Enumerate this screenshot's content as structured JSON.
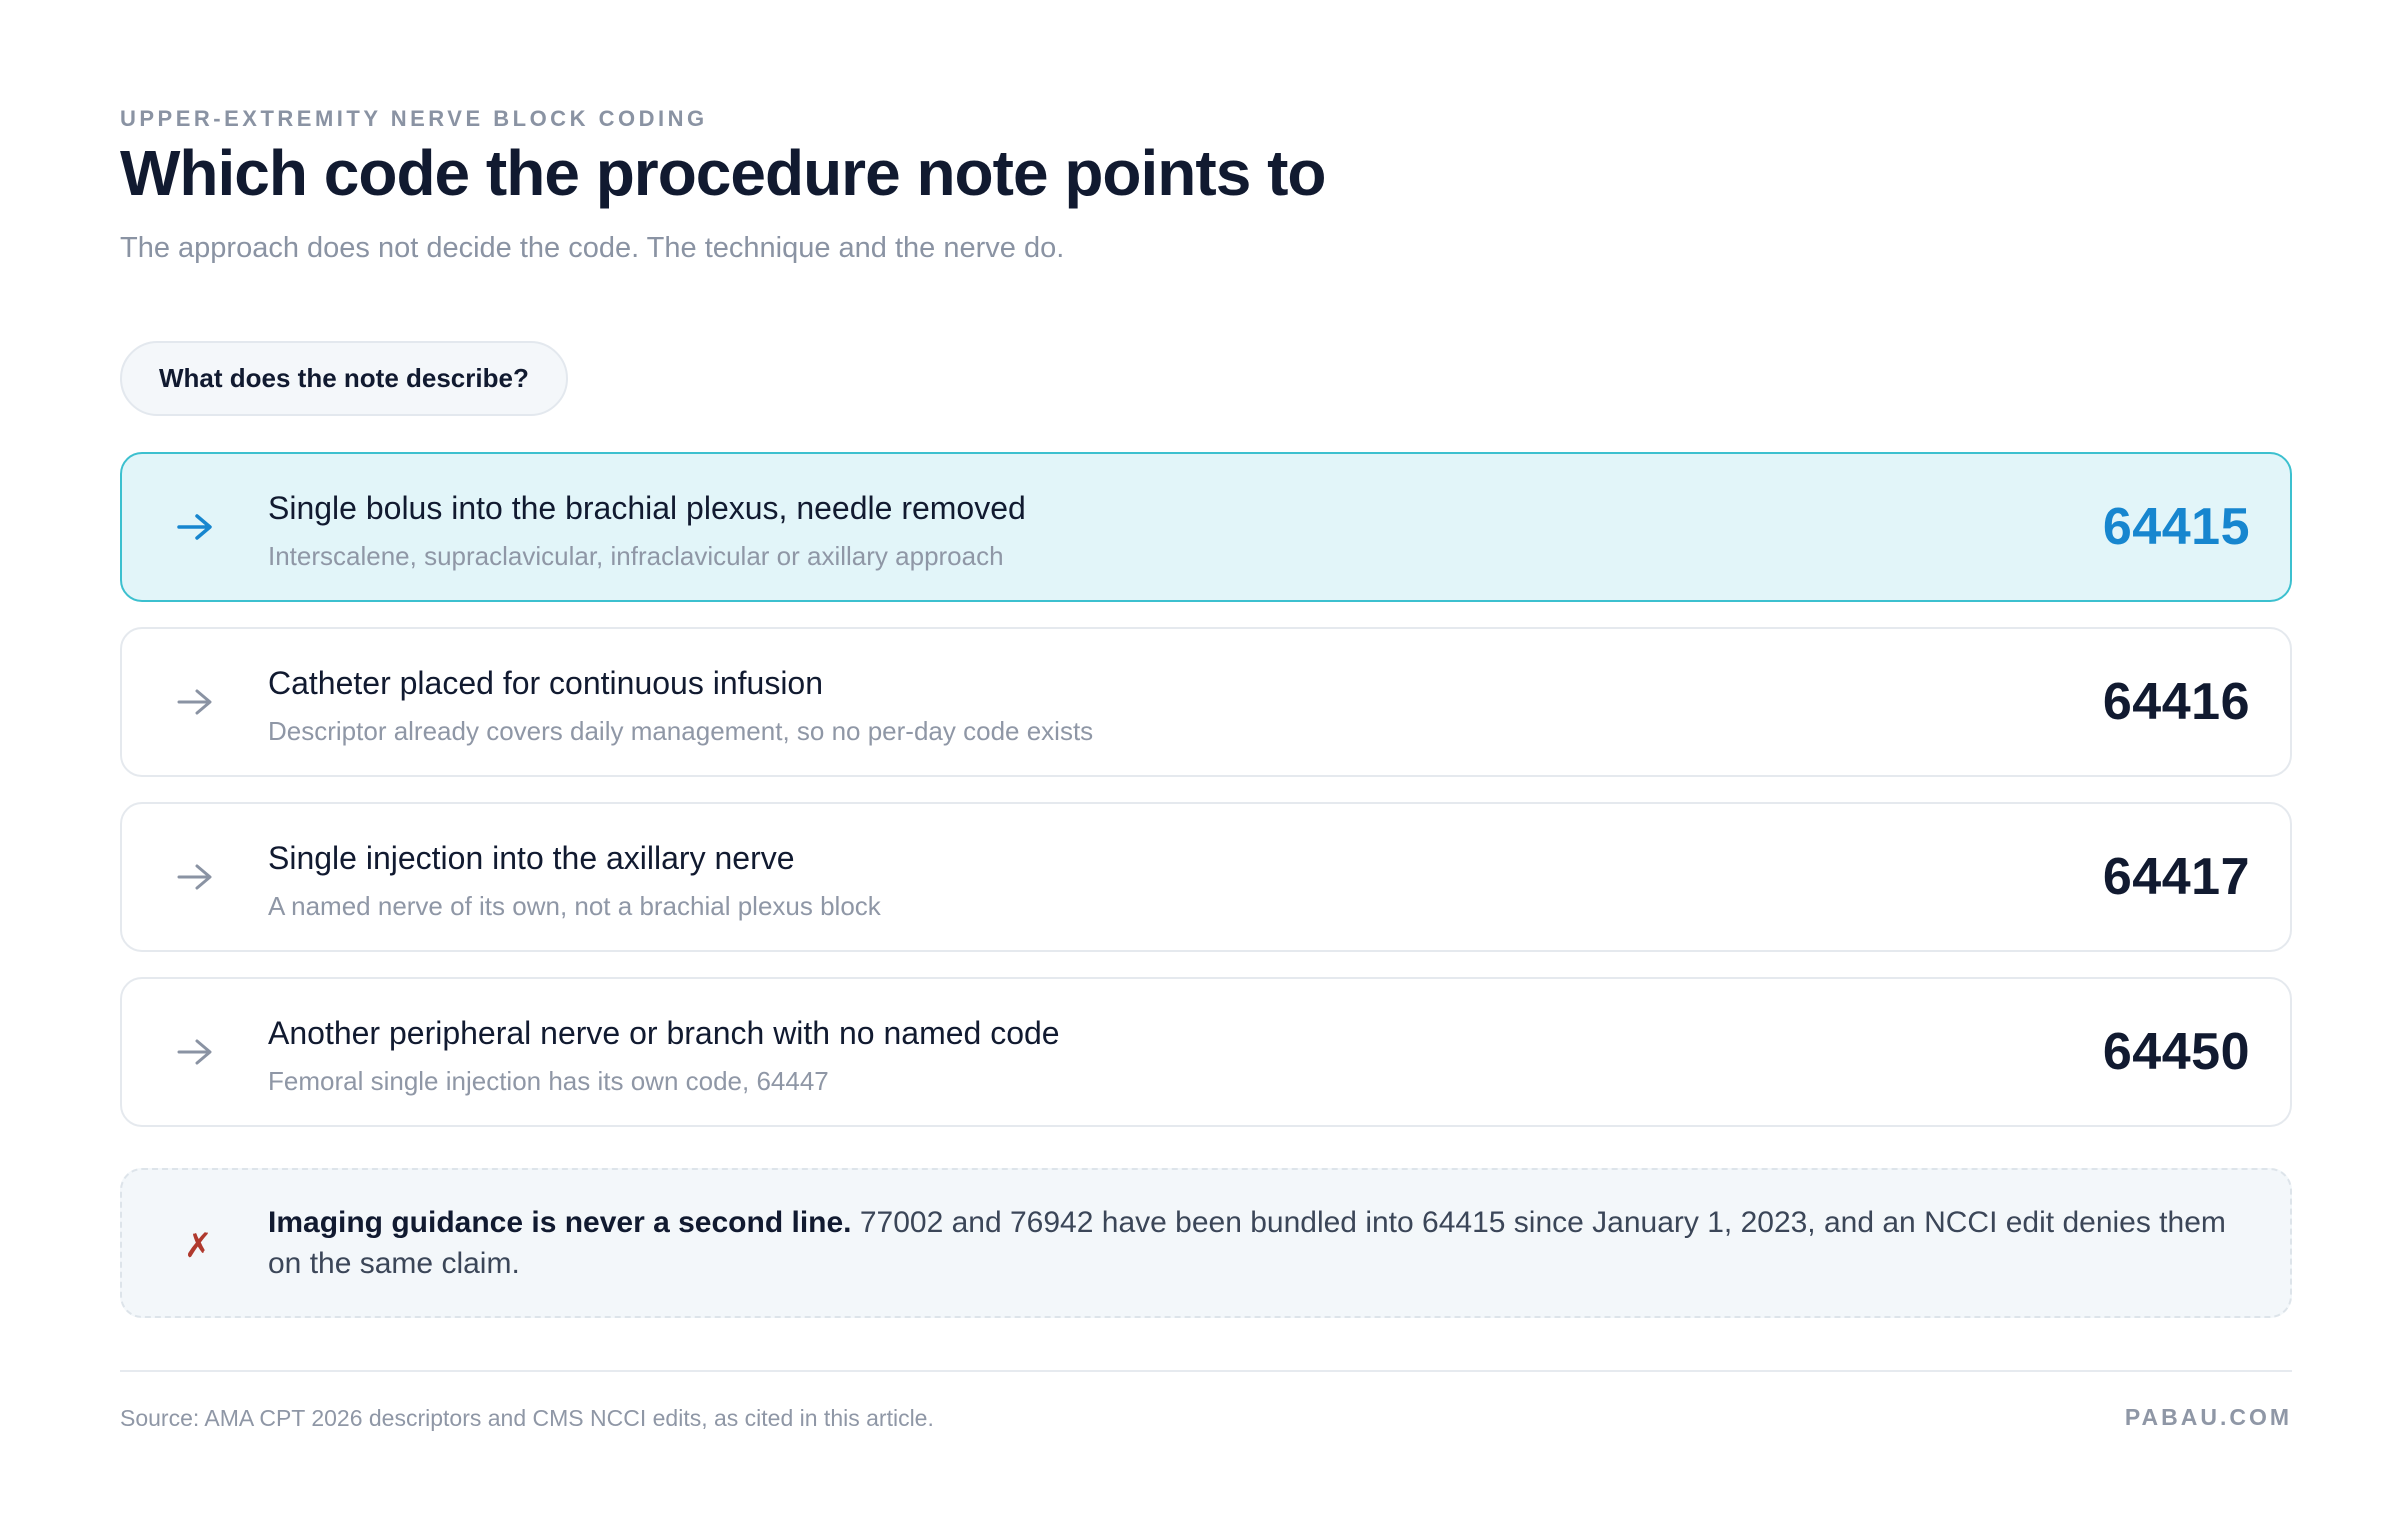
{
  "header": {
    "eyebrow": "UPPER-EXTREMITY NERVE BLOCK CODING",
    "title": "Which code the procedure note points to",
    "subtitle": "The approach does not decide the code. The technique and the nerve do."
  },
  "question": "What does the note describe?",
  "options": [
    {
      "label": "Single bolus into the brachial plexus, needle removed",
      "description": "Interscalene, supraclavicular, infraclavicular or axillary approach",
      "code": "64415",
      "selected": true
    },
    {
      "label": "Catheter placed for continuous infusion",
      "description": "Descriptor already covers daily management, so no per-day code exists",
      "code": "64416",
      "selected": false
    },
    {
      "label": "Single injection into the axillary nerve",
      "description": "A named nerve of its own, not a brachial plexus block",
      "code": "64417",
      "selected": false
    },
    {
      "label": "Another peripheral nerve or branch with no named code",
      "description": "Femoral single injection has its own code, 64447",
      "code": "64450",
      "selected": false
    }
  ],
  "note": {
    "icon": "x-mark-icon",
    "strong": "Imaging guidance is never a second line.",
    "text": " 77002 and 76942 have been bundled into 64415 since January 1, 2023, and an NCCI edit denies them on the same claim."
  },
  "footer": {
    "source": "Source: AMA CPT 2026 descriptors and CMS NCCI edits, as cited in this article.",
    "brand": "PABAU.COM"
  },
  "colors": {
    "selected_background": "#e2f5f9",
    "selected_border": "#3cc0cf",
    "selected_code": "#1786cf",
    "arrow_selected": "#1786cf",
    "arrow_default": "#8a93a3",
    "x_mark": "#b03a2e"
  }
}
